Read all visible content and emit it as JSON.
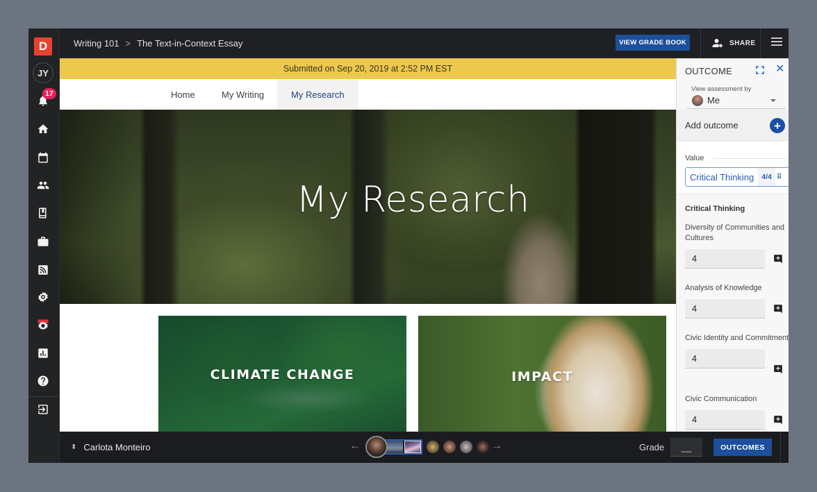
{
  "app": {
    "logo_letter": "D",
    "user_initials": "JY",
    "notification_count": "17"
  },
  "breadcrumb": {
    "items": [
      "Writing 101",
      "The Text-in-Context Essay"
    ],
    "separator": ">"
  },
  "topbar": {
    "gradebook_label": "VIEW GRADE BOOK",
    "share_label": "SHARE"
  },
  "sidebar": {
    "items": [
      {
        "icon": "home-icon"
      },
      {
        "icon": "calendar-icon"
      },
      {
        "icon": "people-icon"
      },
      {
        "icon": "book-icon"
      },
      {
        "icon": "briefcase-icon"
      },
      {
        "icon": "rss-feed-icon"
      },
      {
        "icon": "settings-gear-icon"
      },
      {
        "icon": "beta-gear-icon",
        "badge": "BETA"
      },
      {
        "icon": "analytics-icon"
      },
      {
        "icon": "help-icon"
      },
      {
        "icon": "sign-in-icon"
      }
    ]
  },
  "banner": {
    "text": "Submitted on Sep 20, 2019 at 2:52 PM EST",
    "color": "#ecc84e"
  },
  "page": {
    "tabs": [
      {
        "label": "Home",
        "active": false
      },
      {
        "label": "My Writing",
        "active": false
      },
      {
        "label": "My Research",
        "active": true
      }
    ],
    "hero_title": "My Research",
    "cards": [
      {
        "label": "CLIMATE CHANGE"
      },
      {
        "label": "IMPACT"
      }
    ]
  },
  "outcome_panel": {
    "title": "OUTCOME",
    "view_assessment_label": "View assessment by",
    "view_assessment_value": "Me",
    "add_outcome_label": "Add outcome",
    "value_label": "Value",
    "value_chip": {
      "name": "Critical Thinking",
      "score": "4/4"
    },
    "section_title": "Critical Thinking",
    "criteria": [
      {
        "name": "Diversity of Communities and Cultures",
        "value": "4"
      },
      {
        "name": "Analysis of Knowledge",
        "value": "4"
      },
      {
        "name": "Civic Identity and Commitment",
        "value": "4"
      },
      {
        "name": "Civic Communication",
        "value": "4"
      }
    ]
  },
  "bottombar": {
    "student_name": "Carlota Monteiro",
    "grade_label": "Grade",
    "grade_value": "__",
    "outcomes_label": "OUTCOMES"
  },
  "colors": {
    "accent_blue": "#1c4f9c",
    "notification_badge": "#e8205a",
    "logo_red": "#e6432e",
    "chat_yellow": "#eec94d"
  }
}
